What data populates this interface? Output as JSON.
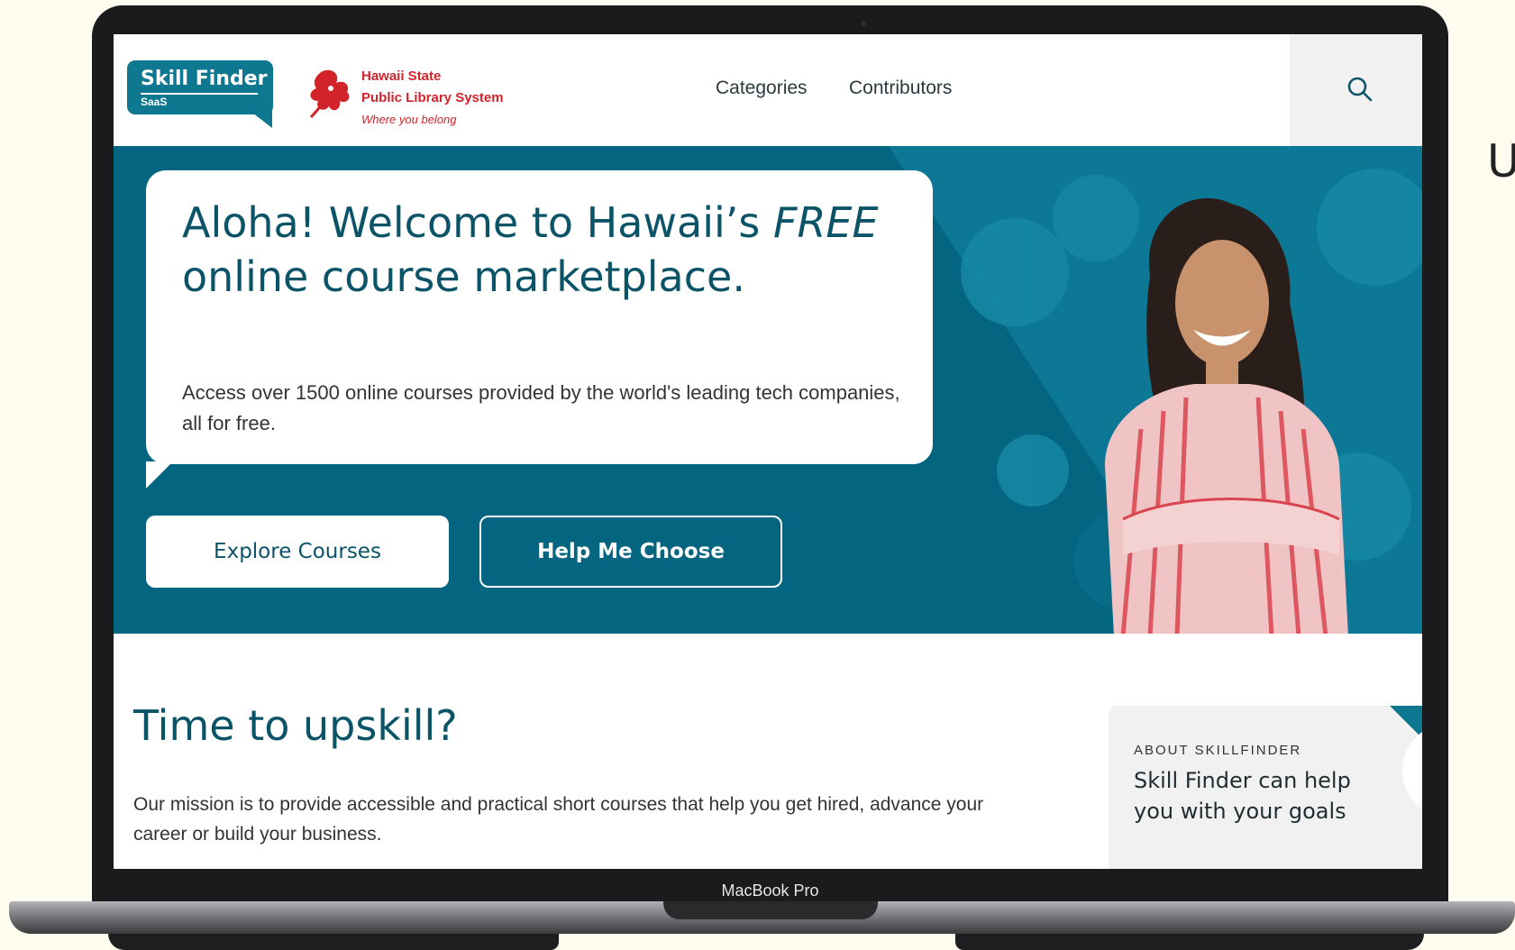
{
  "page_edge_text": "U",
  "device": {
    "label": "MacBook Pro"
  },
  "header": {
    "skill_finder": {
      "name": "Skill Finder",
      "sub": "SaaS"
    },
    "library": {
      "line1": "Hawaii State",
      "line2": "Public Library System",
      "tagline": "Where you belong"
    },
    "nav": [
      {
        "label": "Categories"
      },
      {
        "label": "Contributors"
      }
    ],
    "search_icon": "search-icon"
  },
  "hero": {
    "title_part1": "Aloha! Welcome to Hawaii’s",
    "title_em": "FREE",
    "title_part2": " online course marketplace.",
    "description": "Access over 1500 online courses provided by the world's leading tech companies, all for free.",
    "explore_label": "Explore Courses",
    "help_label": "Help Me Choose"
  },
  "section": {
    "title": "Time to upskill?",
    "mission": "Our mission is to provide accessible and practical short courses that help you get hired, advance your career or build your business."
  },
  "about_card": {
    "kicker": "ABOUT SKILLFINDER",
    "text": "Skill Finder can help you with your goals",
    "icon": "trending-up-icon"
  },
  "colors": {
    "brand_teal": "#0e7891",
    "hero_bg": "#046581",
    "heading": "#0b5468",
    "library_red": "#d2232a",
    "page_bg": "#fdfcee"
  }
}
